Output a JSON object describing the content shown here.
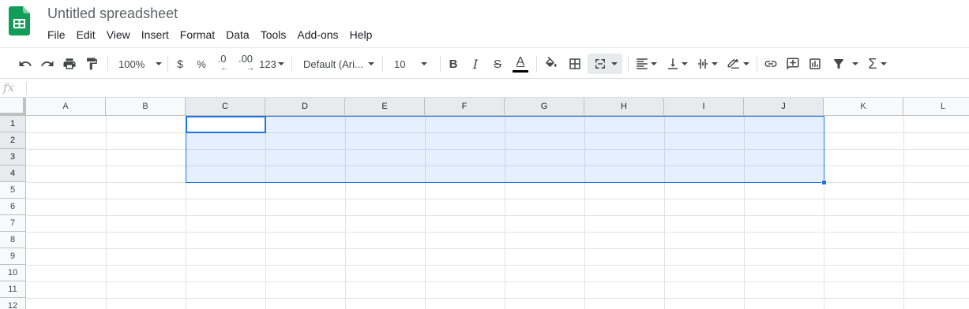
{
  "app": {
    "title": "Untitled spreadsheet",
    "brand_color": "#0f9d58"
  },
  "menu": [
    "File",
    "Edit",
    "View",
    "Insert",
    "Format",
    "Data",
    "Tools",
    "Add-ons",
    "Help"
  ],
  "toolbar": {
    "zoom": "100%",
    "currency": "$",
    "percent": "%",
    "decrease_decimal": ".0",
    "increase_decimal": ".00",
    "more_formats": "123",
    "font": "Default (Ari...",
    "font_size": "10",
    "bold": "B",
    "italic": "I",
    "strikethrough": "S",
    "text_color_glyph": "A",
    "icons": [
      "undo-icon",
      "redo-icon",
      "print-icon",
      "paint-format-icon",
      "fill-color-icon",
      "borders-icon",
      "merge-cells-icon",
      "align-icon",
      "valign-icon",
      "text-wrap-icon",
      "text-rotate-icon",
      "link-icon",
      "comment-icon",
      "chart-icon",
      "filter-icon",
      "functions-icon"
    ]
  },
  "formula_bar": {
    "fx": "fx",
    "value": ""
  },
  "grid": {
    "columns": [
      "A",
      "B",
      "C",
      "D",
      "E",
      "F",
      "G",
      "H",
      "I",
      "J",
      "K",
      "L"
    ],
    "rows": [
      "1",
      "2",
      "3",
      "4",
      "5",
      "6",
      "7",
      "8",
      "9",
      "10",
      "11",
      "12"
    ],
    "selection": "C1:J4",
    "active_cell": "C1",
    "selection_color": "#1a73e8"
  }
}
